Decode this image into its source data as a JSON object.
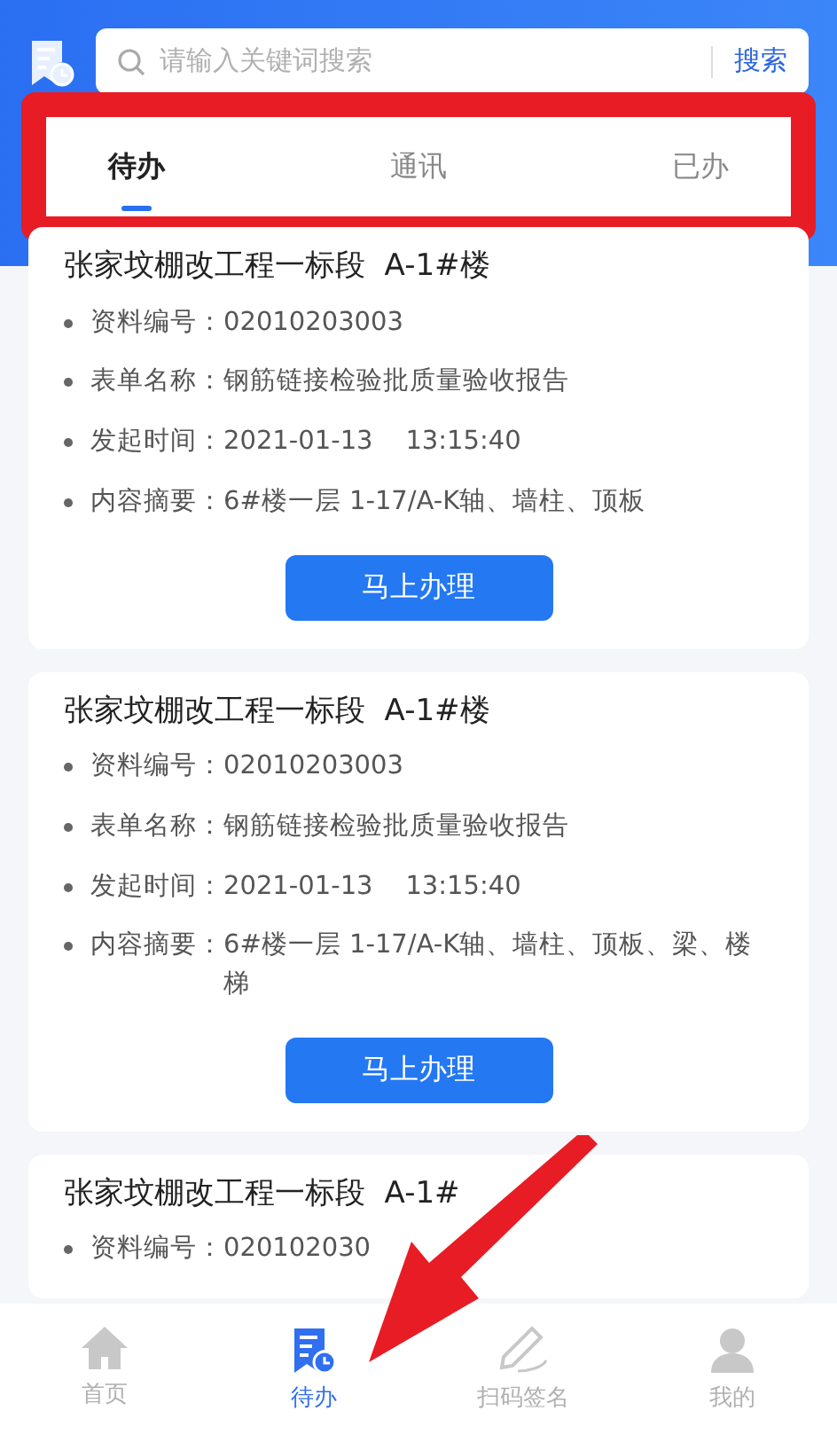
{
  "search": {
    "placeholder": "请输入关键词搜索",
    "button": "搜索"
  },
  "tabs": [
    {
      "label": "待办",
      "selected": true
    },
    {
      "label": "通讯",
      "selected": false
    },
    {
      "label": "已办",
      "selected": false
    }
  ],
  "cards": [
    {
      "title": "张家坟棚改工程一标段  A-1#楼",
      "fields": [
        {
          "label": "资料编号：",
          "value": "02010203003"
        },
        {
          "label": "表单名称：",
          "value": "钢筋链接检验批质量验收报告"
        },
        {
          "label": "发起时间：",
          "value": "2021-01-13    13:15:40"
        },
        {
          "label": "内容摘要：",
          "value": "6#楼一层 1-17/A-K轴、墙柱、顶板"
        }
      ],
      "action": "马上办理"
    },
    {
      "title": "张家坟棚改工程一标段  A-1#楼",
      "fields": [
        {
          "label": "资料编号：",
          "value": "02010203003"
        },
        {
          "label": "表单名称：",
          "value": "钢筋链接检验批质量验收报告"
        },
        {
          "label": "发起时间：",
          "value": "2021-01-13    13:15:40"
        },
        {
          "label": "内容摘要：",
          "value": "6#楼一层 1-17/A-K轴、墙柱、顶板、梁、楼梯"
        }
      ],
      "action": "马上办理"
    },
    {
      "title": "张家坟棚改工程一标段  A-1#",
      "fields": [
        {
          "label": "资料编号：",
          "value": "020102030"
        }
      ]
    }
  ],
  "nav": [
    {
      "label": "首页",
      "kind": "home",
      "selected": false
    },
    {
      "label": "待办",
      "kind": "todo",
      "selected": true
    },
    {
      "label": "扫码签名",
      "kind": "sign",
      "selected": false
    },
    {
      "label": "我的",
      "kind": "user",
      "selected": false
    }
  ]
}
